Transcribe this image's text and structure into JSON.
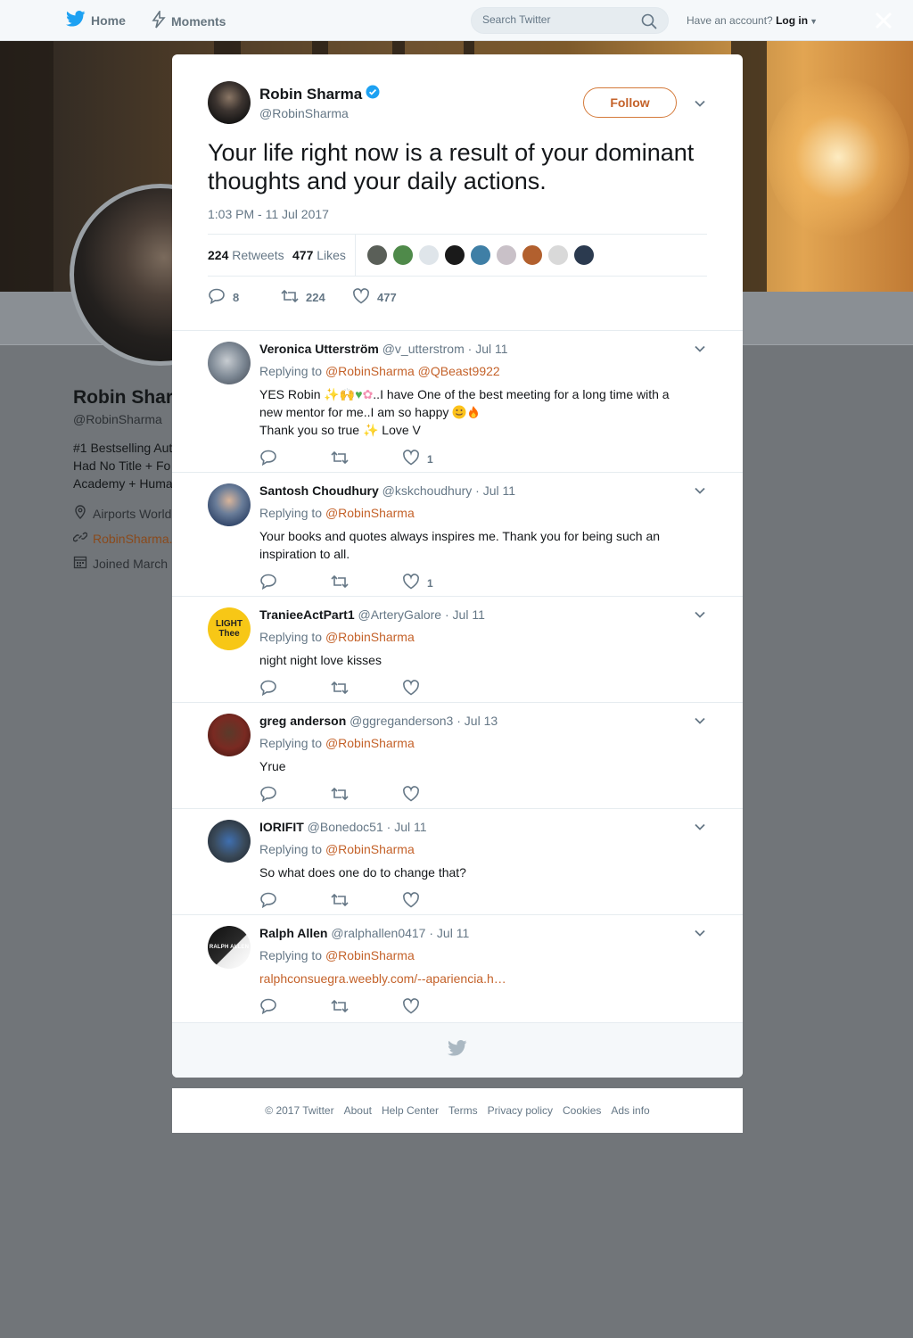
{
  "nav": {
    "home": "Home",
    "moments": "Moments",
    "search_placeholder": "Search Twitter",
    "account_prefix": "Have an account?",
    "login": "Log in"
  },
  "profile": {
    "name": "Robin Shar",
    "handle": "@RobinSharma",
    "bio_lines": [
      "#1 Bestselling Aut",
      "Had No Title + Fo",
      "Academy + Huma"
    ],
    "location": "Airports World",
    "website": "RobinSharma.",
    "joined": "Joined March"
  },
  "tweet": {
    "author_name": "Robin Sharma",
    "author_handle": "@RobinSharma",
    "follow_label": "Follow",
    "text": "Your life right now is a result of your dominant thoughts and your daily actions.",
    "time": "1:03 PM - 11 Jul 2017",
    "retweets": "224",
    "retweets_label": "Retweets",
    "likes": "477",
    "likes_label": "Likes",
    "reply_count": "8",
    "retweet_count": "224",
    "like_count": "477",
    "liker_colors": [
      "#5a5f58",
      "#4f8a4a",
      "#dfe5ea",
      "#1a1a1a",
      "#3f7fa6",
      "#c9c1c8",
      "#b2602e",
      "#d9d9d9",
      "#2b3a4f"
    ]
  },
  "replies": [
    {
      "name": "Veronica Utterström",
      "handle": "@v_utterstrom",
      "date": "Jul 11",
      "replying_label": "Replying to",
      "mentions": "@RobinSharma @QBeast9922",
      "text_line1a": "YES Robin",
      "text_line1b": "..I have One of the best meeting for a long time with a",
      "text_line2": "new mentor for me..I am so happy",
      "text_line3a": "Thank you so true",
      "text_line3b": "Love V",
      "likes": "1",
      "avatar_color": "#7d8894"
    },
    {
      "name": "Santosh Choudhury",
      "handle": "@kskchoudhury",
      "date": "Jul 11",
      "replying_label": "Replying to",
      "mentions": "@RobinSharma",
      "text": "Your books and quotes always inspires me. Thank you for being such an inspiration to all.",
      "likes": "1",
      "avatar_color": "#2d4266"
    },
    {
      "name": "TranieeActPart1",
      "handle": "@ArteryGalore",
      "date": "Jul 11",
      "replying_label": "Replying to",
      "mentions": "@RobinSharma",
      "text": "night night love kisses",
      "avatar_text1": "LIGHT",
      "avatar_text2": "Thee",
      "avatar_color": "#f7c716"
    },
    {
      "name": "greg anderson",
      "handle": "@ggreganderson3",
      "date": "Jul 13",
      "replying_label": "Replying to",
      "mentions": "@RobinSharma",
      "text": "Yrue",
      "avatar_color": "#7a2a22"
    },
    {
      "name": "IORIFIT",
      "handle": "@Bonedoc51",
      "date": "Jul 11",
      "replying_label": "Replying to",
      "mentions": "@RobinSharma",
      "text": "So what does one do to change that?",
      "avatar_color": "#3a4a5a"
    },
    {
      "name": "Ralph Allen",
      "handle": "@ralphallen0417",
      "date": "Jul 11",
      "replying_label": "Replying to",
      "mentions": "@RobinSharma",
      "text": "ralphconsuegra.weebly.com/--apariencia.h…",
      "avatar_text1": "RALPH ALLEN",
      "avatar_color": "#1b1b1b"
    }
  ],
  "footer": {
    "copyright": "© 2017 Twitter",
    "links": [
      "About",
      "Help Center",
      "Terms",
      "Privacy policy",
      "Cookies",
      "Ads info"
    ]
  },
  "colors": {
    "accent_orange": "#c4622a",
    "twitter_blue": "#1da1f2",
    "verified_blue": "#1da1f2"
  }
}
